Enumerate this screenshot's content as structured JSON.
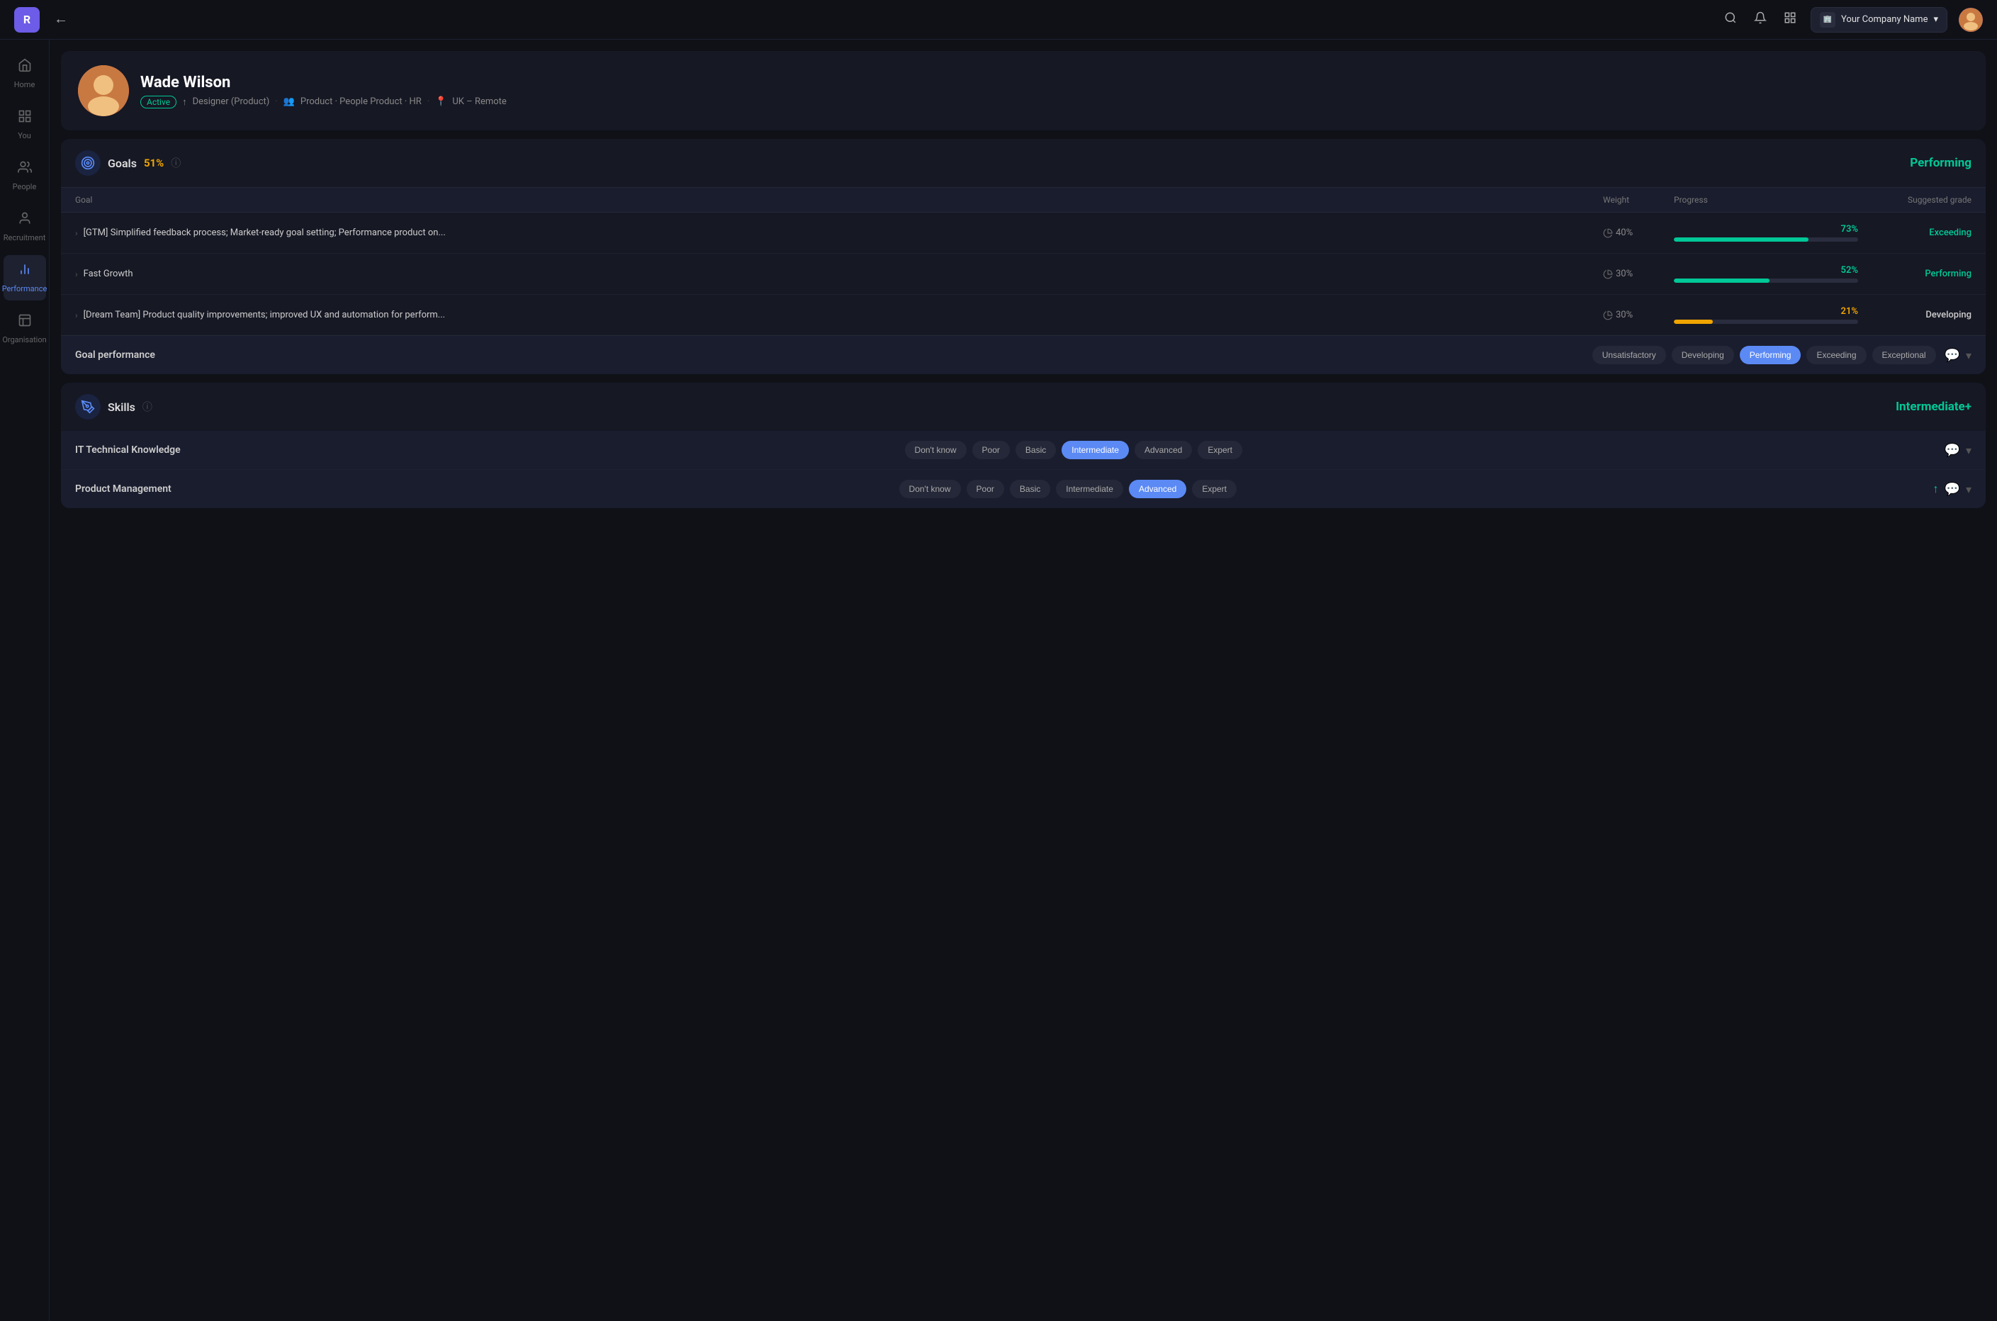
{
  "header": {
    "logo": "R",
    "back_label": "←",
    "search_icon": "🔍",
    "bell_icon": "🔔",
    "grid_icon": "⋮⋮",
    "company_name": "Your Company Name",
    "chevron_down": "▾"
  },
  "sidebar": {
    "items": [
      {
        "id": "home",
        "icon": "🏠",
        "label": "Home"
      },
      {
        "id": "you",
        "icon": "📋",
        "label": "You"
      },
      {
        "id": "people",
        "icon": "👥",
        "label": "People"
      },
      {
        "id": "recruitment",
        "icon": "👤",
        "label": "Recruitment"
      },
      {
        "id": "performance",
        "icon": "📊",
        "label": "Performance",
        "active": true
      },
      {
        "id": "organisation",
        "icon": "🏢",
        "label": "Organisation"
      }
    ]
  },
  "profile": {
    "name": "Wade Wilson",
    "status": "Active",
    "role": "Designer (Product)",
    "team": "Product · People Product · HR",
    "location": "UK – Remote",
    "avatar_emoji": "🧑"
  },
  "goals_section": {
    "title": "Goals",
    "percent": "51%",
    "score": "Performing",
    "table_headers": {
      "goal": "Goal",
      "weight": "Weight",
      "progress": "Progress",
      "suggested_grade": "Suggested grade"
    },
    "rows": [
      {
        "text": "[GTM] Simplified feedback process; Market-ready goal setting; Performance product on...",
        "weight": "40%",
        "progress_pct": "73%",
        "progress_value": 73,
        "bar_color": "#00c896",
        "grade": "Exceeding",
        "grade_class": "grade-exceeding"
      },
      {
        "text": "Fast Growth",
        "weight": "30%",
        "progress_pct": "52%",
        "progress_value": 52,
        "bar_color": "#00c896",
        "grade": "Performing",
        "grade_class": "grade-performing"
      },
      {
        "text": "[Dream Team] Product quality improvements; improved UX and automation for perform...",
        "weight": "30%",
        "progress_pct": "21%",
        "progress_value": 21,
        "bar_color": "#f0a500",
        "grade": "Developing",
        "grade_class": "grade-developing"
      }
    ],
    "performance_row": {
      "label": "Goal performance",
      "buttons": [
        {
          "label": "Unsatisfactory",
          "active": false
        },
        {
          "label": "Developing",
          "active": false
        },
        {
          "label": "Performing",
          "active": true
        },
        {
          "label": "Exceeding",
          "active": false
        },
        {
          "label": "Exceptional",
          "active": false
        }
      ]
    }
  },
  "skills_section": {
    "title": "Skills",
    "score": "Intermediate+",
    "rows": [
      {
        "name": "IT Technical Knowledge",
        "buttons": [
          {
            "label": "Don't know",
            "active": false
          },
          {
            "label": "Poor",
            "active": false
          },
          {
            "label": "Basic",
            "active": false
          },
          {
            "label": "Intermediate",
            "active": true
          },
          {
            "label": "Advanced",
            "active": false
          },
          {
            "label": "Expert",
            "active": false
          }
        ],
        "has_up_arrow": false
      },
      {
        "name": "Product Management",
        "buttons": [
          {
            "label": "Don't know",
            "active": false
          },
          {
            "label": "Poor",
            "active": false
          },
          {
            "label": "Basic",
            "active": false
          },
          {
            "label": "Intermediate",
            "active": false
          },
          {
            "label": "Advanced",
            "active": true
          },
          {
            "label": "Expert",
            "active": false
          }
        ],
        "has_up_arrow": true
      }
    ]
  }
}
